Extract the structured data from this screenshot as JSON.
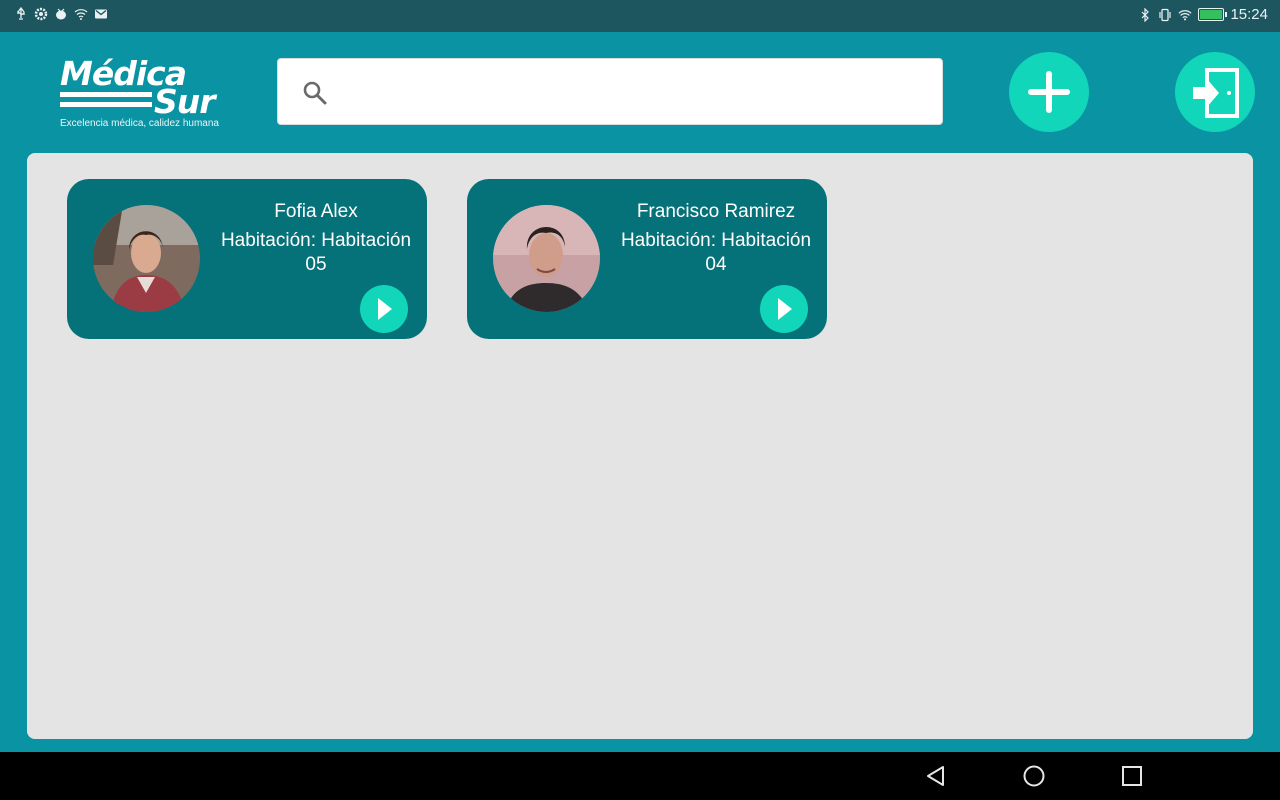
{
  "status_bar": {
    "time": "15:24",
    "left_icons": [
      "usb-icon",
      "settings-gear-icon",
      "android-debug-icon",
      "wifi-question-icon",
      "gmail-icon"
    ],
    "right_icons": [
      "bluetooth-icon",
      "vibrate-icon",
      "wifi-icon",
      "battery-charging-icon"
    ]
  },
  "header": {
    "logo": {
      "line1": "Médica",
      "line2": "Sur",
      "tagline": "Excelencia médica, calidez humana"
    },
    "search": {
      "placeholder": "",
      "value": ""
    },
    "add_button_icon": "plus-icon",
    "exit_button_icon": "exit-door-icon"
  },
  "patients": [
    {
      "name": "Fofia Alex",
      "room_line1": "Habitación: Habitación",
      "room_line2": "05",
      "avatar": "woman-photo"
    },
    {
      "name": "Francisco Ramirez",
      "room_line1": "Habitación: Habitación",
      "room_line2": "04",
      "avatar": "man-photo"
    }
  ],
  "nav_bar": {
    "buttons": [
      "back-icon",
      "home-icon",
      "recents-icon"
    ]
  },
  "colors": {
    "background": "#0a93a3",
    "status_bar": "#1e5660",
    "accent": "#12d6b9",
    "card": "#057178",
    "panel": "#e4e4e4"
  }
}
